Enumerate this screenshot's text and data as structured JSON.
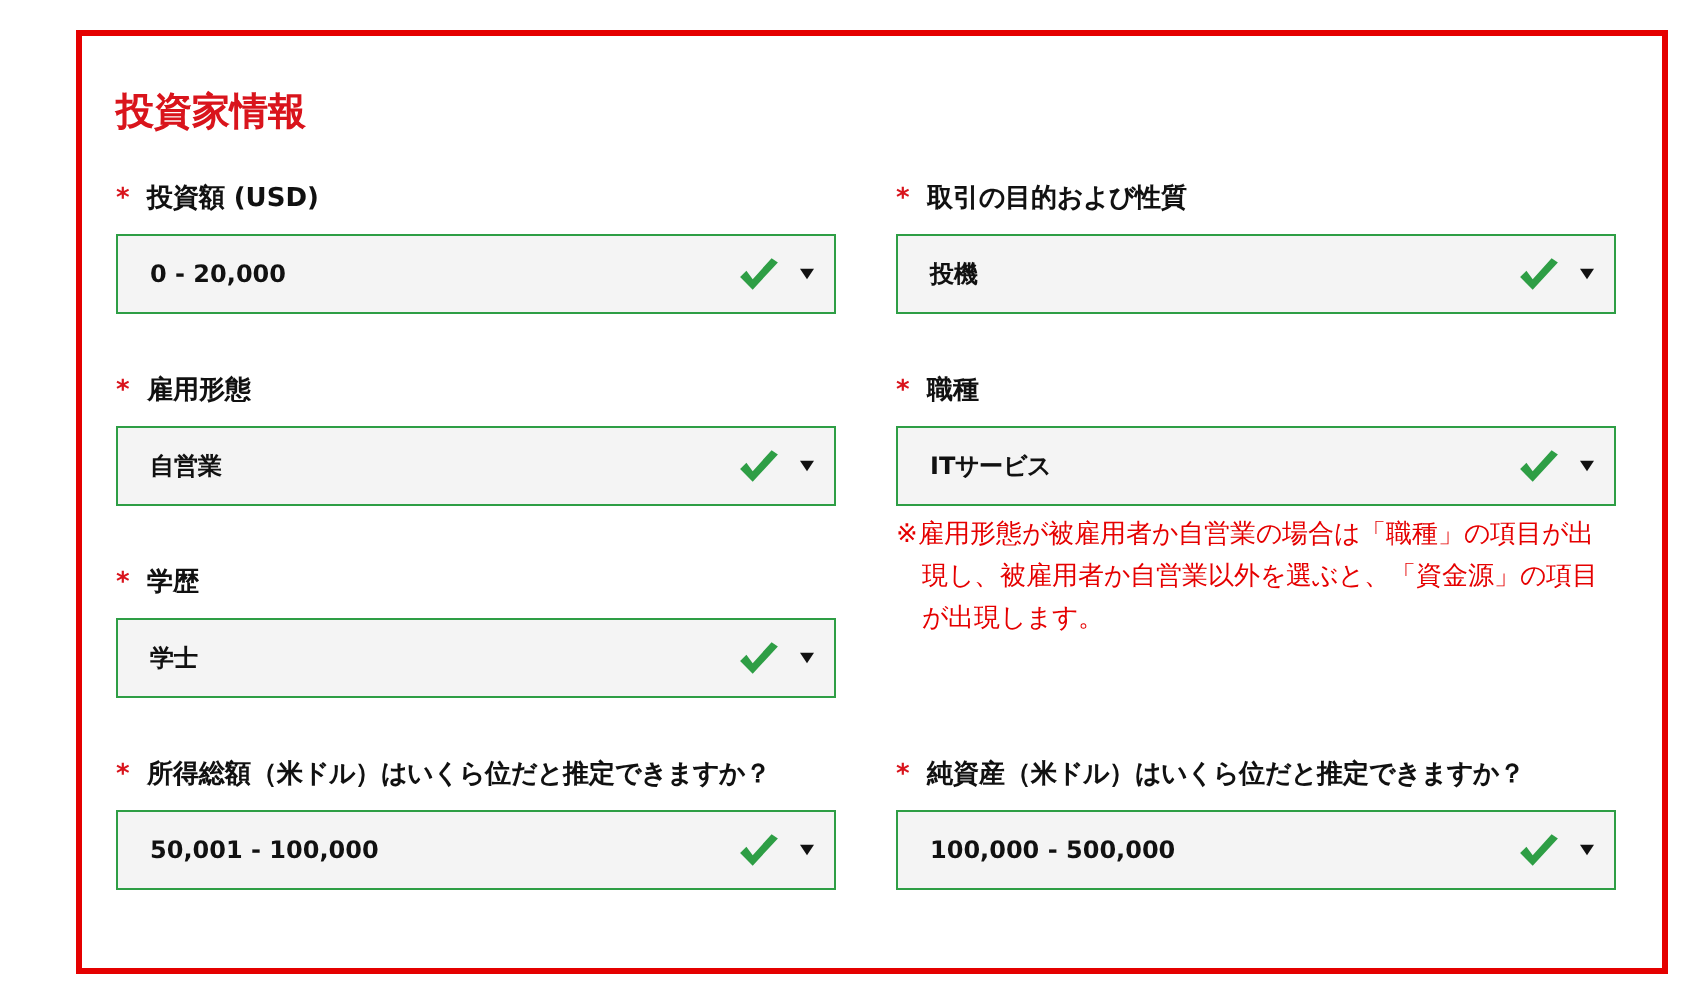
{
  "title": "投資家情報",
  "fields": [
    {
      "label": "投資額 (USD)",
      "marker": "*",
      "value": "0 - 20,000",
      "valid": true
    },
    {
      "label": "取引の目的および性質",
      "marker": "*",
      "value": "投機",
      "valid": true
    },
    {
      "label": "雇用形態",
      "marker": "*",
      "value": "自営業",
      "valid": true
    },
    {
      "label": "職種",
      "marker": "*",
      "value": "ITサービス",
      "valid": true
    },
    {
      "label": "学歴",
      "marker": "*",
      "value": "学士",
      "valid": true
    },
    {
      "label": "所得総額（米ドル）はいくら位だと推定できますか？",
      "marker": "*",
      "value": "50,001 - 100,000",
      "valid": true
    },
    {
      "label": "純資産（米ドル）はいくら位だと推定できますか？",
      "marker": "*",
      "value": "100,000 - 500,000",
      "valid": true
    }
  ],
  "note": "※雇用形態が被雇用者か自営業の場合は「職種」の項目が出現し、被雇用者か自営業以外を選ぶと、「資金源」の項目が出現します。"
}
